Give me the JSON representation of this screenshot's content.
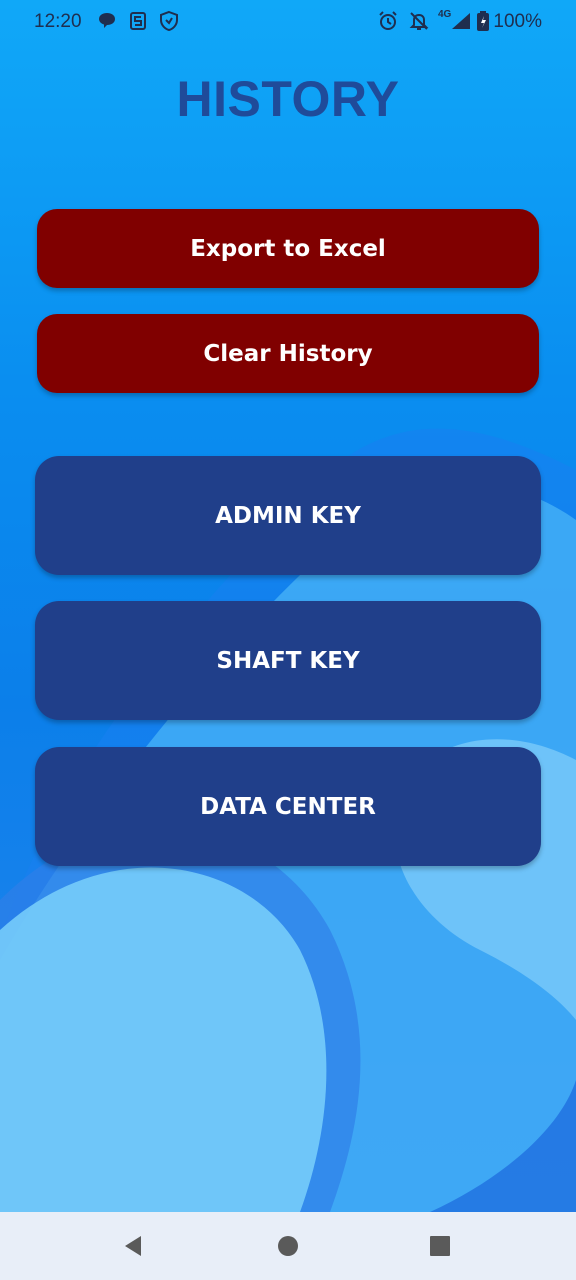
{
  "status_bar": {
    "time": "12:20",
    "network": "4G",
    "battery": "100%",
    "icons": [
      "chat-bubble-icon",
      "s-app-icon",
      "shield-icon",
      "alarm-icon",
      "notifications-off-icon",
      "signal-icon",
      "battery-icon"
    ]
  },
  "header": {
    "title": "HISTORY"
  },
  "actions": {
    "export_label": "Export to Excel",
    "clear_label": "Clear History"
  },
  "menu": {
    "items": [
      {
        "label": "ADMIN KEY"
      },
      {
        "label": "SHAFT KEY"
      },
      {
        "label": "DATA CENTER"
      }
    ]
  },
  "nav": {
    "icons": [
      "back-icon",
      "home-icon",
      "recents-icon"
    ]
  },
  "colors": {
    "title": "#1f4b9a",
    "action_button": "#800000",
    "menu_button": "#203f8a",
    "background": "#0a8ef0"
  }
}
